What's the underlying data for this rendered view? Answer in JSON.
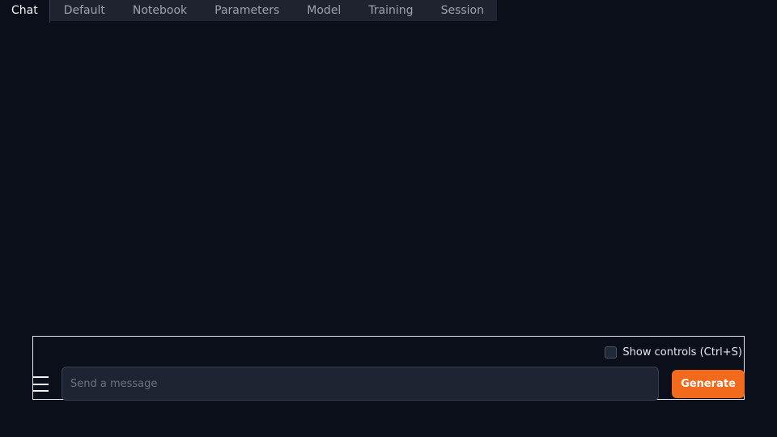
{
  "tabs": [
    {
      "label": "Chat",
      "active": true
    },
    {
      "label": "Default",
      "active": false
    },
    {
      "label": "Notebook",
      "active": false
    },
    {
      "label": "Parameters",
      "active": false
    },
    {
      "label": "Model",
      "active": false
    },
    {
      "label": "Training",
      "active": false
    },
    {
      "label": "Session",
      "active": false
    }
  ],
  "input_panel": {
    "show_controls_label": "Show controls (Ctrl+S)",
    "show_controls_checked": false,
    "message_placeholder": "Send a message",
    "message_value": "",
    "generate_label": "Generate",
    "menu_icon": "hamburger-menu-icon"
  },
  "colors": {
    "background": "#0b0f19",
    "tab_background": "#1f2330",
    "input_background": "#1f2432",
    "accent": "#f26b1d"
  }
}
